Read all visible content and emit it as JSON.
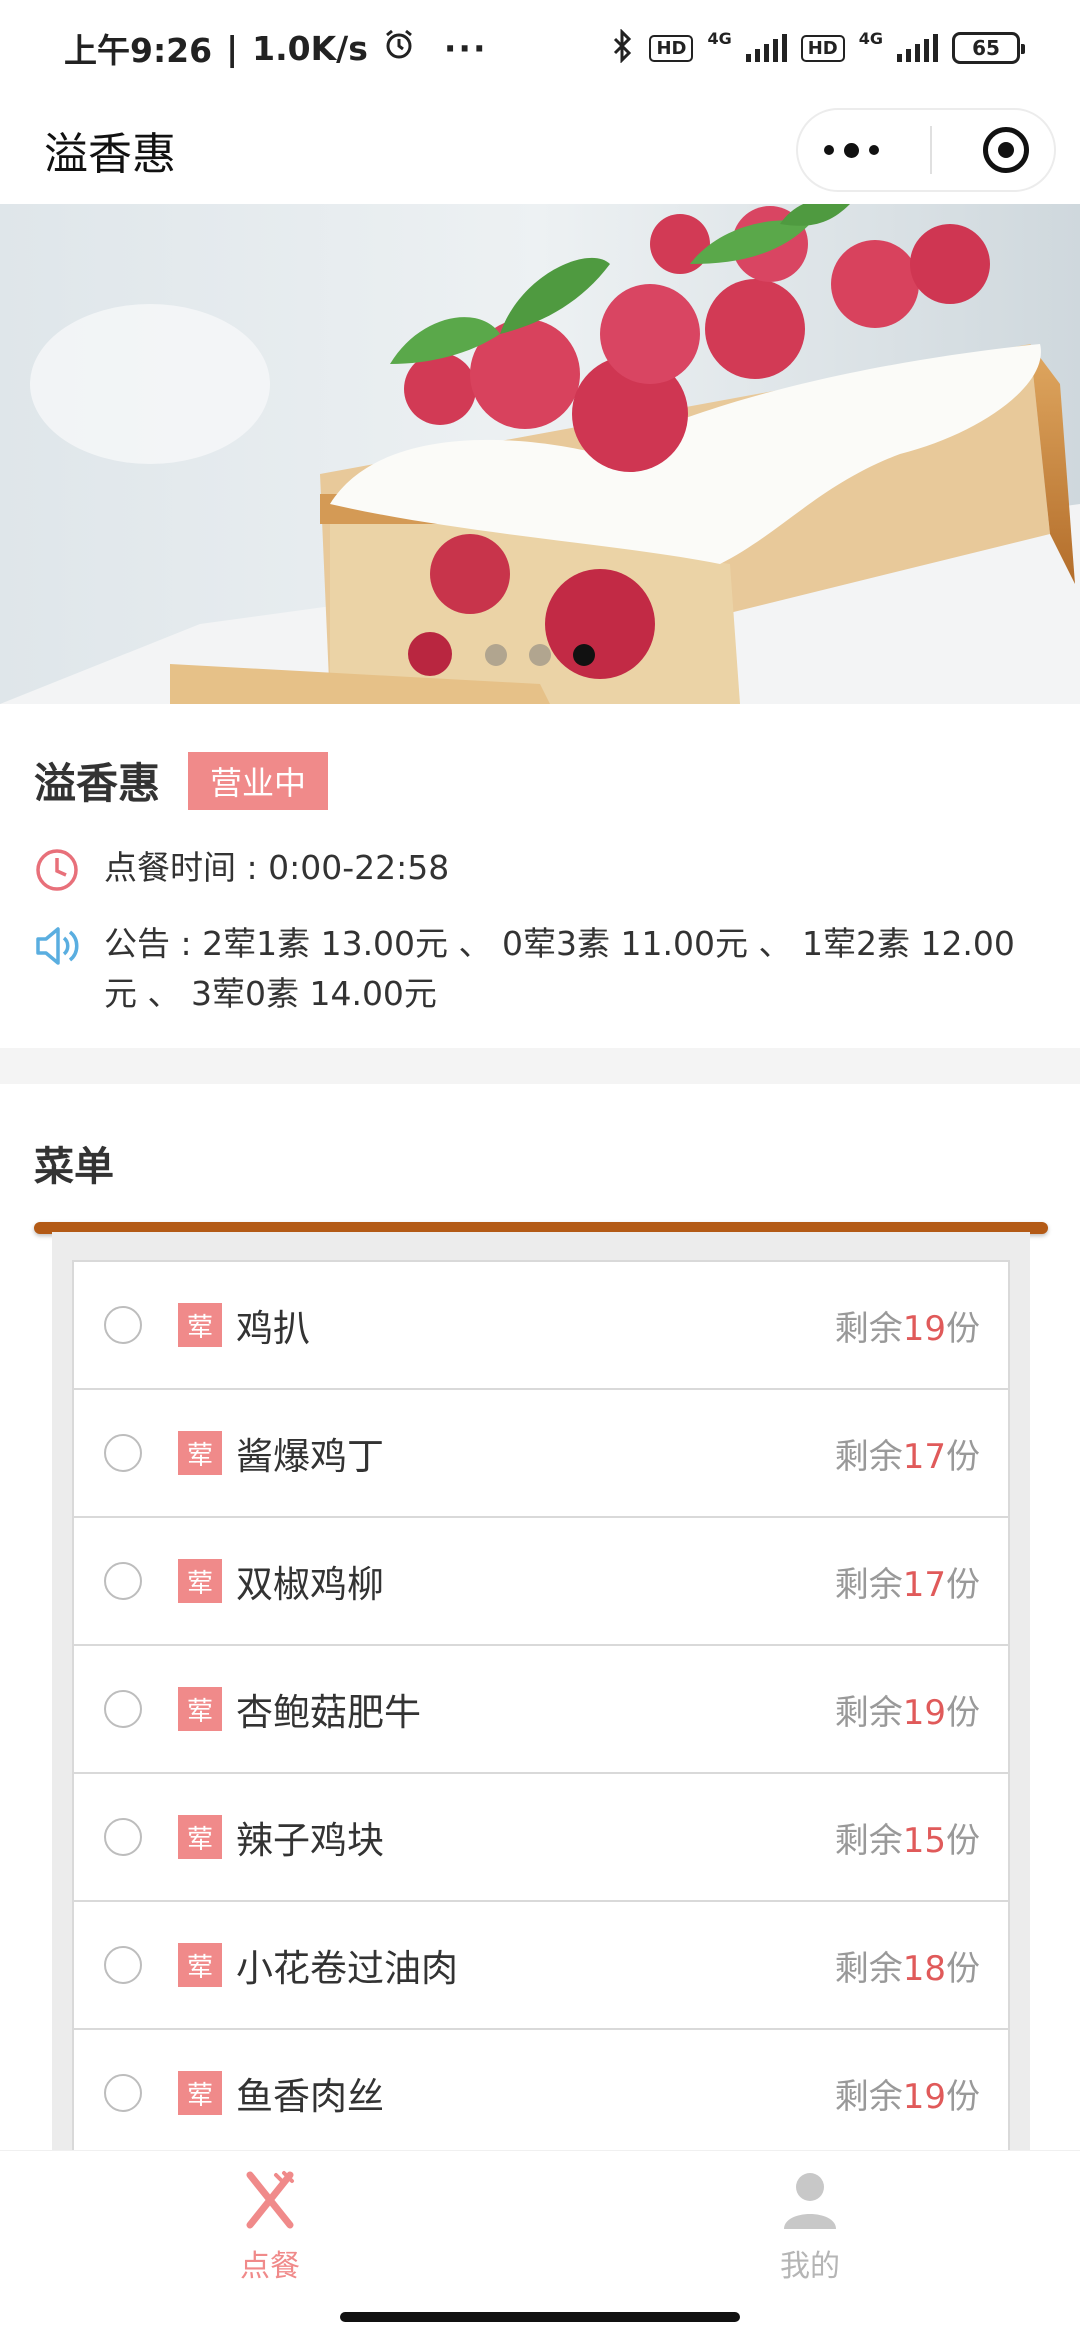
{
  "status_bar": {
    "time": "上午9:26",
    "net_speed": "1.0K/s",
    "more": "···",
    "hd1": "HD",
    "net1": "4G",
    "hd2": "HD",
    "net2": "4G",
    "battery": "65"
  },
  "nav": {
    "title": "溢香惠"
  },
  "banner": {
    "dot_count": 3,
    "active_index": 2
  },
  "shop": {
    "name": "溢香惠",
    "status": "营业中",
    "hours": "点餐时间 : 0:00-22:58",
    "notice": "公告 : 2荤1素 13.00元 、 0荤3素 11.00元 、 1荤2素 12.00元 、 3荤0素 14.00元"
  },
  "menu": {
    "title": "菜单",
    "remain_prefix": "剩余",
    "remain_suffix": "份",
    "items": [
      {
        "tag": "荤",
        "name": "鸡扒",
        "count": "19"
      },
      {
        "tag": "荤",
        "name": "酱爆鸡丁",
        "count": "17"
      },
      {
        "tag": "荤",
        "name": "双椒鸡柳",
        "count": "17"
      },
      {
        "tag": "荤",
        "name": "杏鲍菇肥牛",
        "count": "19"
      },
      {
        "tag": "荤",
        "name": "辣子鸡块",
        "count": "15"
      },
      {
        "tag": "荤",
        "name": "小花卷过油肉",
        "count": "18"
      },
      {
        "tag": "荤",
        "name": "鱼香肉丝",
        "count": "19"
      }
    ]
  },
  "tabbar": {
    "order": "点餐",
    "mine": "我的"
  },
  "colors": {
    "accent": "#f08a8a",
    "count_red": "#e05a5a",
    "rail": "#b35a16"
  }
}
